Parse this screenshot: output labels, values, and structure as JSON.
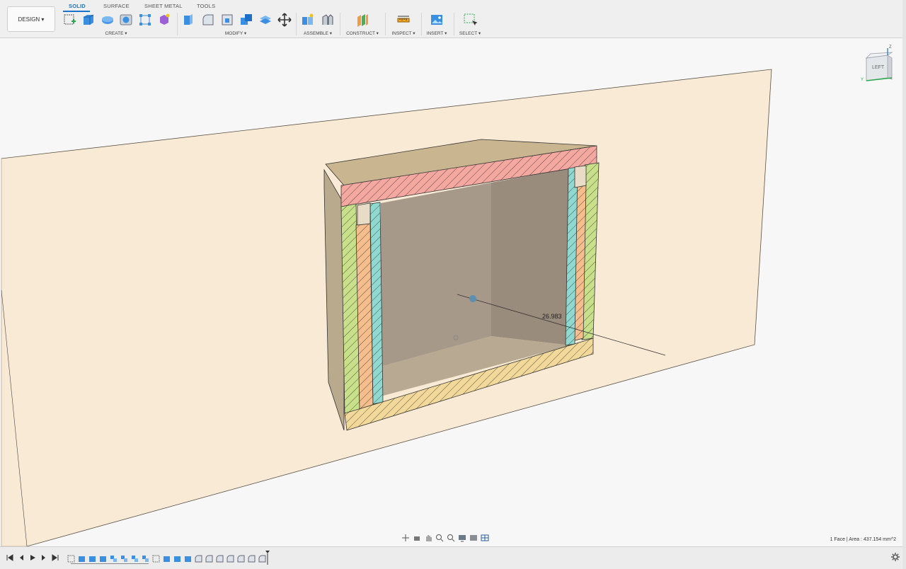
{
  "workspace": {
    "label": "DESIGN ▾"
  },
  "tabs": [
    {
      "label": "SOLID",
      "active": true
    },
    {
      "label": "SURFACE",
      "active": false
    },
    {
      "label": "SHEET METAL",
      "active": false
    },
    {
      "label": "TOOLS",
      "active": false
    }
  ],
  "groups": {
    "create": "CREATE ▾",
    "modify": "MODIFY ▾",
    "assemble": "ASSEMBLE ▾",
    "construct": "CONSTRUCT ▾",
    "inspect": "INSPECT ▾",
    "insert": "INSERT ▾",
    "select": "SELECT ▾"
  },
  "tools": {
    "create": [
      "sketch-icon",
      "extrude-icon",
      "revolve-icon",
      "hole-icon",
      "pattern-icon",
      "form-icon"
    ],
    "modify": [
      "press-pull-icon",
      "fillet-icon",
      "shell-icon",
      "combine-icon",
      "offset-face-icon",
      "move-icon"
    ],
    "assemble": [
      "new-component-icon",
      "joint-icon"
    ],
    "construct": [
      "plane-icon"
    ],
    "inspect": [
      "measure-icon"
    ],
    "insert": [
      "insert-image-icon"
    ],
    "select": [
      "select-window-icon"
    ]
  },
  "viewcube": {
    "face_label": "LEFT",
    "axis_z": "Z",
    "axis_y": "Y"
  },
  "viewport": {
    "dimension_value": "26.983"
  },
  "status": {
    "selection": "1 Face | Area : 437.154 mm^2"
  },
  "colors": {
    "accent": "#1a73c8",
    "plane": "#f9ead5",
    "section_red": "#f4a8a0",
    "section_green": "#c9e08a",
    "section_orange": "#f5be8c",
    "section_teal": "#8fd9d0",
    "section_yellow": "#f2d99a",
    "body": "#b9a98d"
  }
}
